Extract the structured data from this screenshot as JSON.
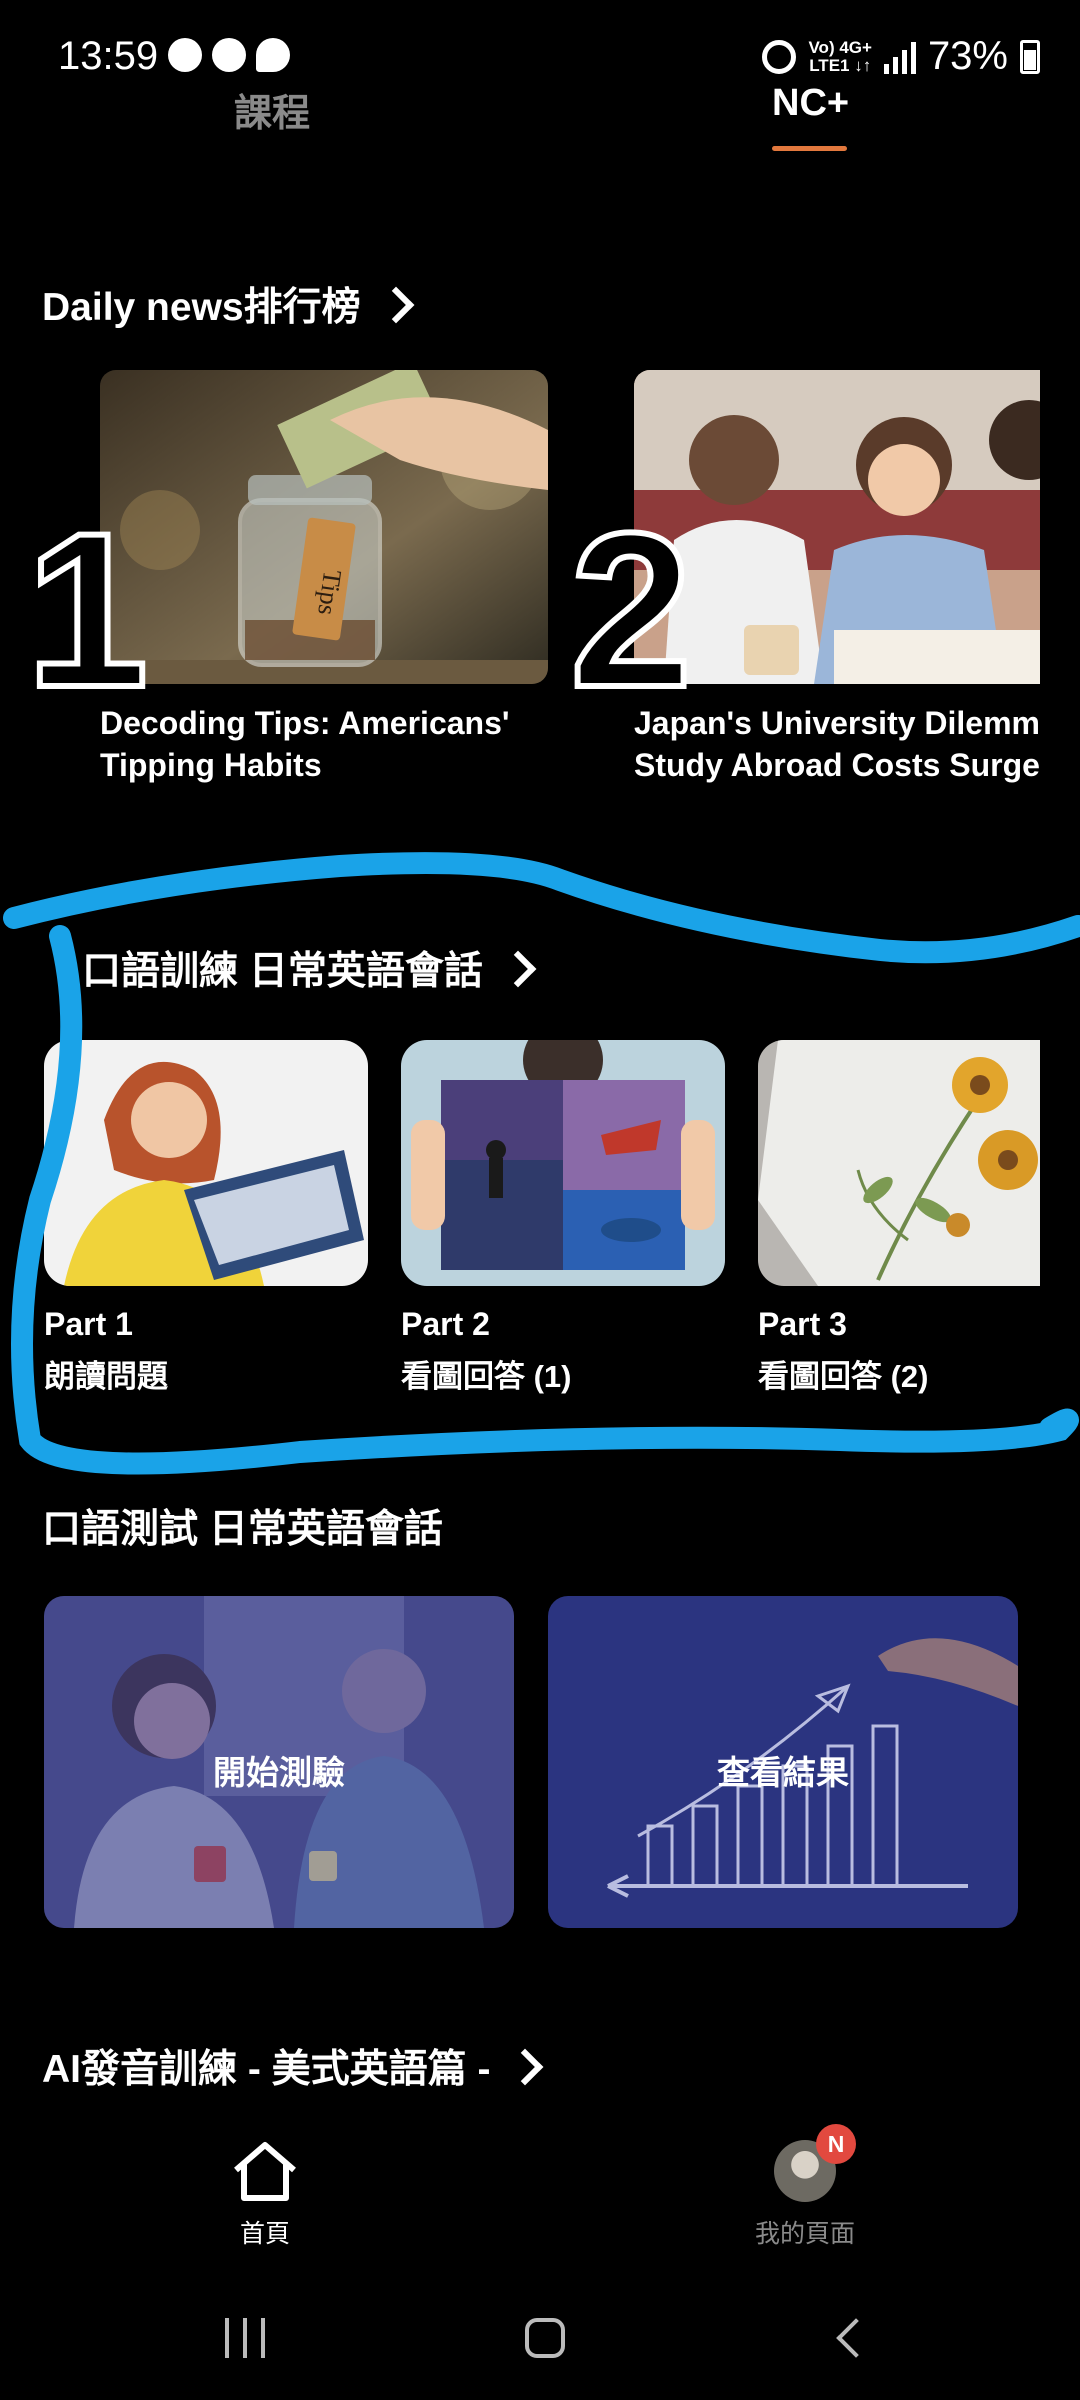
{
  "status_bar": {
    "time": "13:59",
    "network_top": "Vo) 4G+",
    "network_bottom": "LTE1 ↓↑",
    "battery": "73%"
  },
  "tabs": [
    {
      "label": "課程",
      "active": false
    },
    {
      "label": "NC+",
      "active": true
    }
  ],
  "daily_news": {
    "header": "Daily news排行榜",
    "items": [
      {
        "rank": "1",
        "title_line1": "Decoding Tips: Americans'",
        "title_line2": "Tipping Habits",
        "image_icon": "tip-jar-photo"
      },
      {
        "rank": "2",
        "title_line1": "Japan's University Dilemma",
        "title_line2": "Study Abroad Costs Surge",
        "image_icon": "students-studying-photo"
      }
    ]
  },
  "speaking_training": {
    "header": "口語訓練 日常英語會話",
    "parts": [
      {
        "label": "Part 1",
        "sub": "朗讀問題"
      },
      {
        "label": "Part 2",
        "sub": "看圖回答 (1)"
      },
      {
        "label": "Part 3",
        "sub": "看圖回答 (2)"
      }
    ]
  },
  "speaking_test": {
    "header": "口語測試 日常英語會話",
    "cards": [
      {
        "label": "開始測驗"
      },
      {
        "label": "查看結果"
      }
    ]
  },
  "ai_pronunciation": {
    "header": "AI發音訓練 - 美式英語篇 -"
  },
  "bottom_nav": {
    "home": "首頁",
    "my_page": "我的頁面",
    "badge": "N"
  },
  "colors": {
    "accent": "#e2783d",
    "annotation": "#1aa3e8",
    "badge": "#e2493f"
  }
}
